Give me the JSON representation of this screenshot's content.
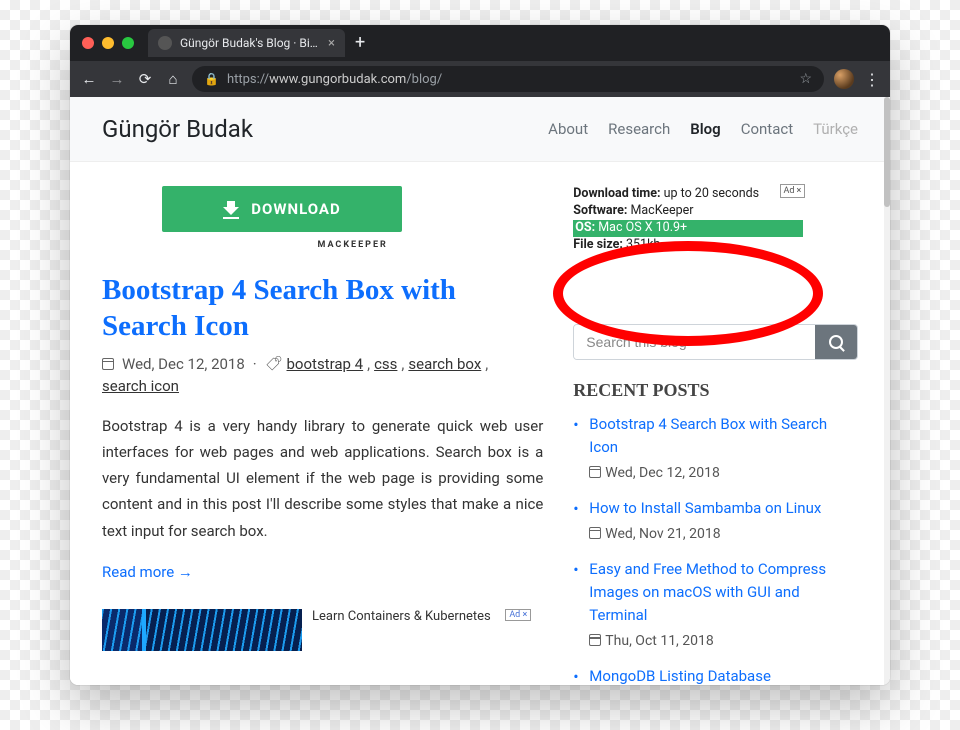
{
  "browser": {
    "tab_title": "Güngör Budak's Blog · Bioinfor",
    "url_display": "https://www.gungorbudak.com/blog/",
    "url_proto": "https://",
    "url_host": "www.gungorbudak.com",
    "url_path": "/blog/"
  },
  "header": {
    "brand": "Güngör Budak",
    "nav": {
      "about": "About",
      "research": "Research",
      "blog": "Blog",
      "contact": "Contact",
      "turkce": "Türkçe"
    }
  },
  "ad1": {
    "button": "DOWNLOAD",
    "sublabel": "MACKEEPER",
    "rows": {
      "dl_label": "Download time:",
      "dl_value": " up to 20 seconds",
      "sw_label": "Software:",
      "sw_value": " MacKeeper",
      "os_label": "OS:",
      "os_value": " Mac OS X 10.9+",
      "size_label": "File size:",
      "size_value": " 351kb"
    },
    "tag": "Ad"
  },
  "post": {
    "title": "Bootstrap 4 Search Box with Search Icon",
    "date": "Wed, Dec 12, 2018",
    "tags": {
      "t1": "bootstrap 4",
      "t2": "css",
      "t3": "search box",
      "t4": "search icon"
    },
    "excerpt": "Bootstrap 4 is a very handy library to generate quick web user interfaces for web pages and web applications. Search box is a very fundamental UI element if the web page is providing some content and in this post I'll describe some styles that make a nice text input for search box.",
    "readmore": "Read more →"
  },
  "sidebar": {
    "search_placeholder": "Search this blog",
    "recent_title": "RECENT POSTS",
    "posts": [
      {
        "title": "Bootstrap 4 Search Box with Search Icon",
        "date": "Wed, Dec 12, 2018"
      },
      {
        "title": "How to Install Sambamba on Linux",
        "date": "Wed, Nov 21, 2018"
      },
      {
        "title": "Easy and Free Method to Compress Images on macOS with GUI and Terminal",
        "date": "Thu, Oct 11, 2018"
      },
      {
        "title": "MongoDB Listing Database",
        "date": ""
      }
    ]
  },
  "ad2": {
    "text": "Learn Containers & Kubernetes",
    "tag": "Ad ×"
  }
}
